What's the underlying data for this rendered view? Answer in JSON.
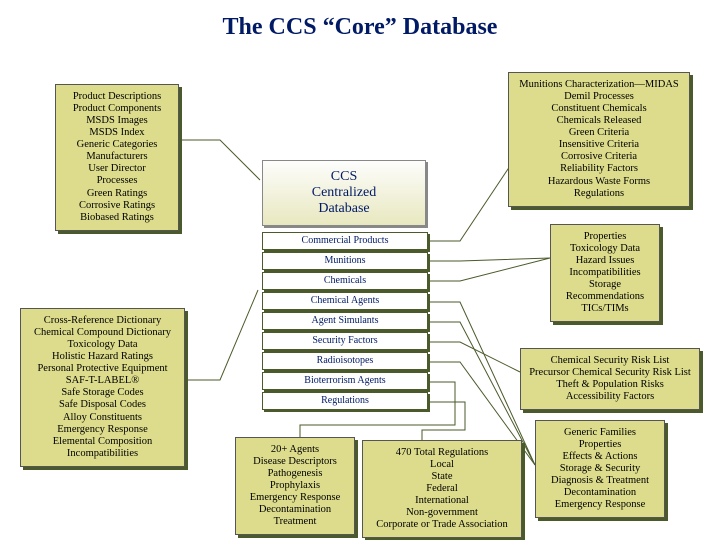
{
  "title": "The CCS “Core” Database",
  "center_label": [
    "CCS",
    "Centralized",
    "Database"
  ],
  "slots": [
    "Commercial Products",
    "Munitions",
    "Chemicals",
    "Chemical Agents",
    "Agent Simulants",
    "Security Factors",
    "Radioisotopes",
    "Bioterrorism Agents",
    "Regulations"
  ],
  "left_top": [
    "Product Descriptions",
    "Product Components",
    "MSDS Images",
    "MSDS Index",
    "Generic Categories",
    "Manufacturers",
    "User Director",
    "Processes",
    "Green Ratings",
    "Corrosive Ratings",
    "Biobased Ratings"
  ],
  "left_bottom": [
    "Cross-Reference Dictionary",
    "Chemical Compound Dictionary",
    "Toxicology Data",
    "Holistic Hazard Ratings",
    "Personal Protective Equipment",
    "SAF-T-LABEL®",
    "Safe Storage Codes",
    "Safe Disposal Codes",
    "Alloy Constituents",
    "Emergency Response",
    "Elemental Composition",
    "Incompatibilities"
  ],
  "right_top": [
    "Munitions Characterization—MIDAS",
    "Demil Processes",
    "Constituent Chemicals",
    "Chemicals Released",
    "Green Criteria",
    "Insensitive Criteria",
    "Corrosive Criteria",
    "Reliability Factors",
    "Hazardous Waste Forms",
    "Regulations"
  ],
  "right_mid": [
    "Properties",
    "Toxicology Data",
    "Hazard Issues",
    "Incompatibilities",
    "Storage",
    "Recommendations",
    "TICs/TIMs"
  ],
  "right_sec": [
    "Chemical Security  Risk List",
    "Precursor Chemical Security Risk List",
    "Theft & Population Risks",
    "Accessibility Factors"
  ],
  "right_bottom": [
    "Generic Families",
    "Properties",
    "Effects & Actions",
    "Storage & Security",
    "Diagnosis & Treatment",
    "Decontamination",
    "Emergency Response"
  ],
  "center_bottom_left": [
    "20+ Agents",
    "Disease Descriptors",
    "Pathogenesis",
    "Prophylaxis",
    "Emergency Response",
    "Decontamination",
    "Treatment"
  ],
  "center_bottom_right": [
    "470 Total Regulations",
    "Local",
    "State",
    "Federal",
    "International",
    "Non-government",
    "Corporate or Trade Association"
  ]
}
